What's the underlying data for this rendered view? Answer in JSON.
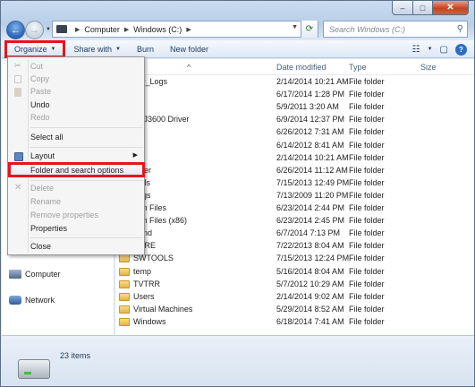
{
  "window": {
    "caption": {
      "minimize": "–",
      "maximize": "□",
      "close": "✕"
    }
  },
  "address": {
    "segments": [
      "Computer",
      "Windows (C:)"
    ],
    "search_placeholder": "Search Windows (C:)"
  },
  "toolbar": {
    "organize": "Organize",
    "share_with": "Share with",
    "burn": "Burn",
    "new_folder": "New folder"
  },
  "columns": {
    "date_modified": "Date modified",
    "type": "Type",
    "size": "Size"
  },
  "files": [
    {
      "name": "Srv_Logs",
      "date": "2/14/2014 10:21 AM",
      "type": "File folder"
    },
    {
      "name": "ers",
      "date": "6/17/2014 1:28 PM",
      "type": "File folder"
    },
    {
      "name": "",
      "date": "5/9/2011 3:20 AM",
      "type": "File folder"
    },
    {
      "name": "CLJ3600 Driver",
      "date": "6/9/2014 12:37 PM",
      "type": "File folder"
    },
    {
      "name": "",
      "date": "6/26/2012 7:31 AM",
      "type": "File folder"
    },
    {
      "name": "",
      "date": "6/14/2012 8:41 AM",
      "type": "File folder"
    },
    {
      "name": "NT",
      "date": "2/14/2014 10:21 AM",
      "type": "File folder"
    },
    {
      "name": "older",
      "date": "6/26/2014 11:12 AM",
      "type": "File folder"
    },
    {
      "name": "tools",
      "date": "7/15/2013 12:49 PM",
      "type": "File folder"
    },
    {
      "name": "Logs",
      "date": "7/13/2009 11:20 PM",
      "type": "File folder"
    },
    {
      "name": "ram Files",
      "date": "6/23/2014 2:44 PM",
      "type": "File folder"
    },
    {
      "name": "ram Files (x86)",
      "date": "6/23/2014 2:45 PM",
      "type": "File folder"
    },
    {
      "name": "Bend",
      "date": "6/7/2014 7:13 PM",
      "type": "File folder"
    },
    {
      "name": "HARE",
      "date": "7/22/2013 8:04 AM",
      "type": "File folder"
    },
    {
      "name": "SWTOOLS",
      "date": "7/15/2013 12:24 PM",
      "type": "File folder"
    },
    {
      "name": "temp",
      "date": "5/16/2014 8:04 AM",
      "type": "File folder"
    },
    {
      "name": "TVTRR",
      "date": "5/7/2012 10:29 AM",
      "type": "File folder"
    },
    {
      "name": "Users",
      "date": "2/14/2014 9:02 AM",
      "type": "File folder"
    },
    {
      "name": "Virtual Machines",
      "date": "5/29/2014 8:52 AM",
      "type": "File folder"
    },
    {
      "name": "Windows",
      "date": "6/18/2014 7:41 AM",
      "type": "File folder"
    }
  ],
  "nav": {
    "computer": "Computer",
    "network": "Network"
  },
  "menu": {
    "cut": "Cut",
    "copy": "Copy",
    "paste": "Paste",
    "undo": "Undo",
    "redo": "Redo",
    "select_all": "Select all",
    "layout": "Layout",
    "folder_options": "Folder and search options",
    "delete": "Delete",
    "rename": "Rename",
    "remove_properties": "Remove properties",
    "properties": "Properties",
    "close": "Close"
  },
  "status": {
    "items": "23 items"
  },
  "colors": {
    "highlight": "#e8141c",
    "toolbar_text": "#1e395b"
  }
}
